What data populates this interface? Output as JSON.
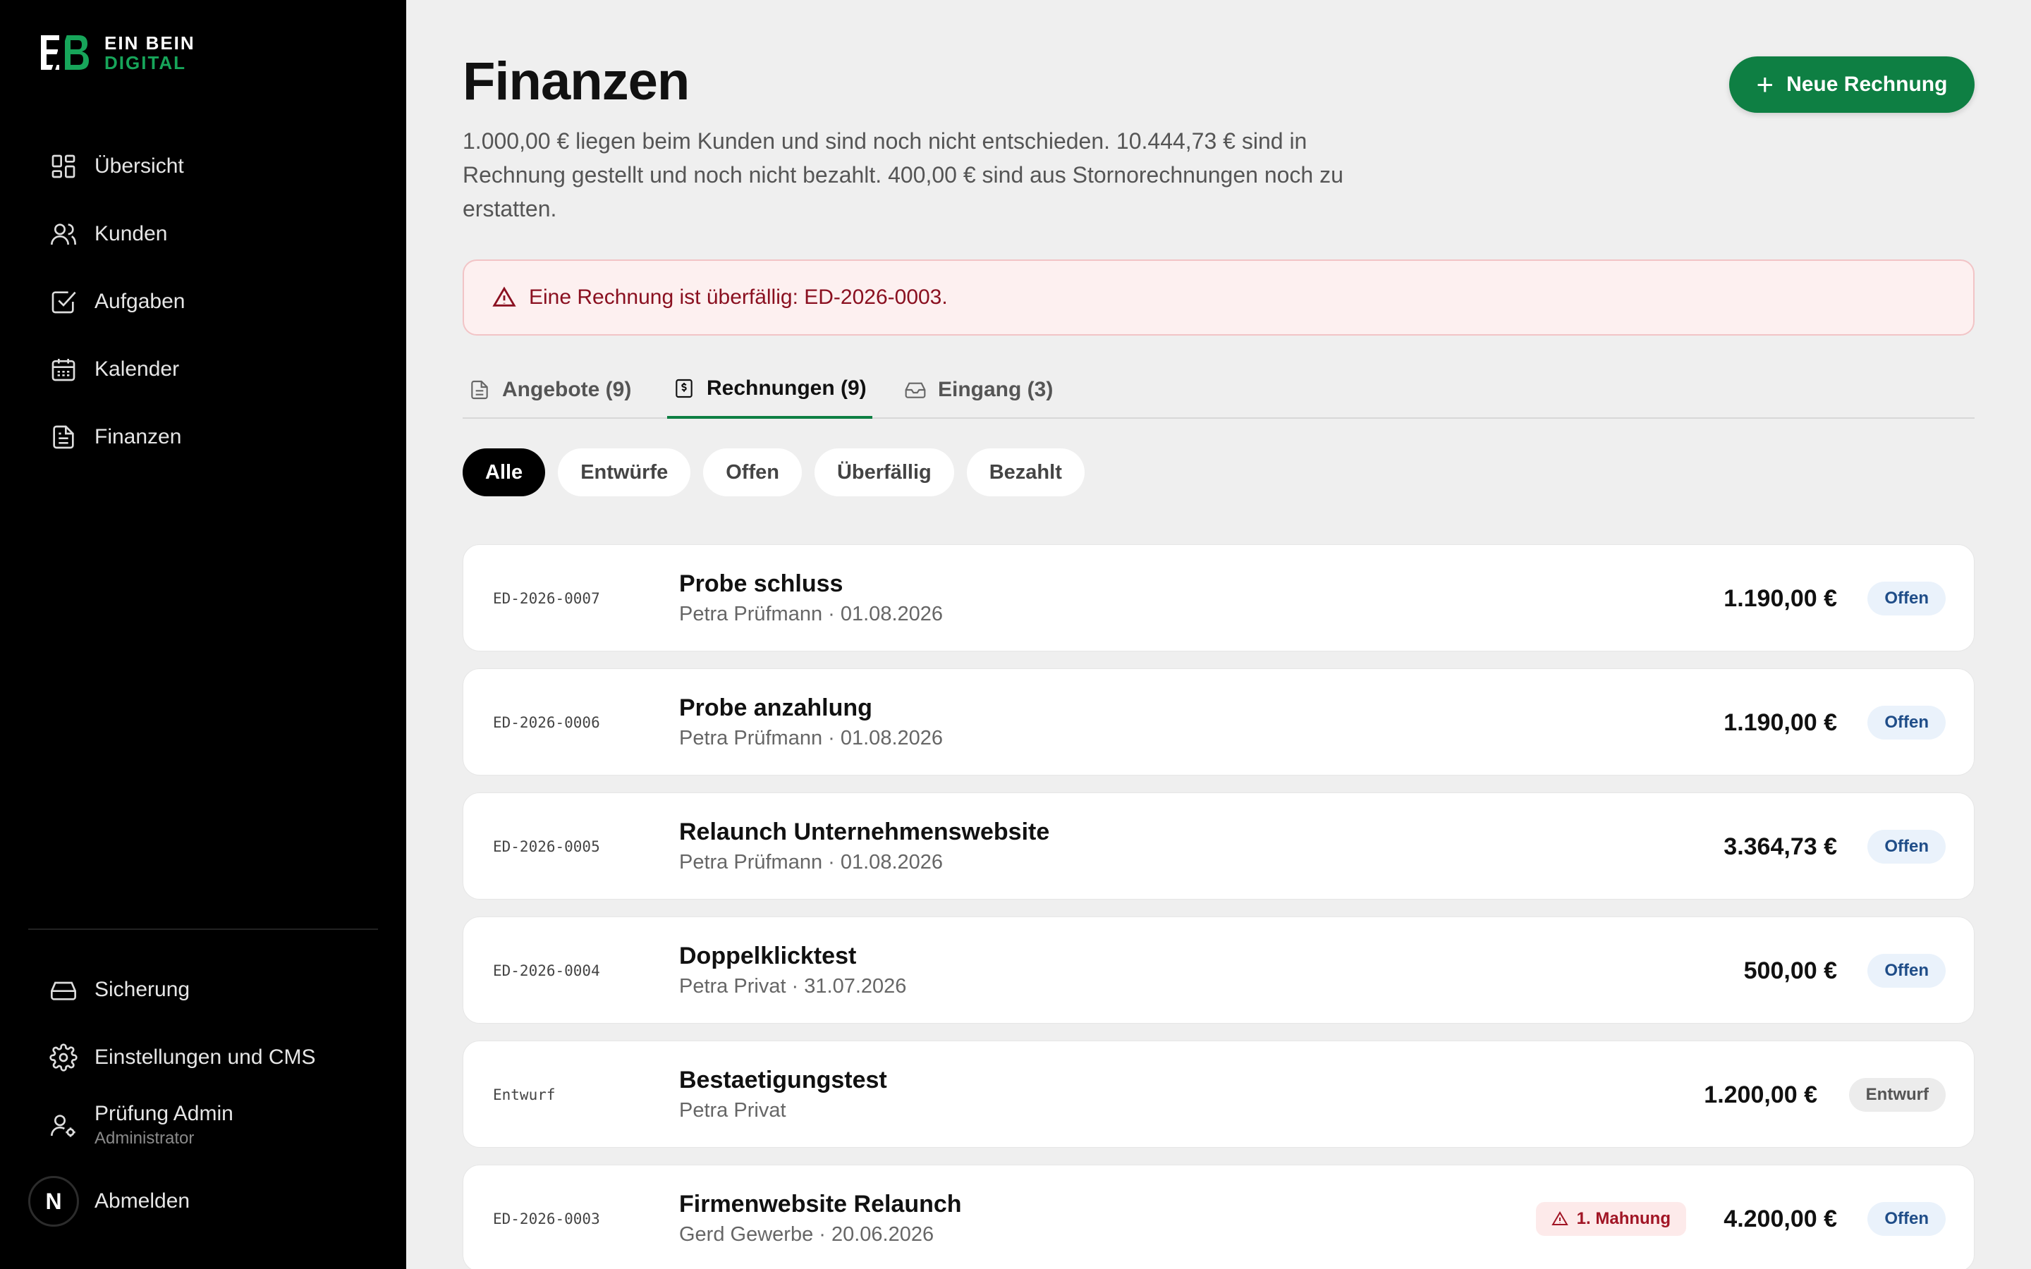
{
  "brand": {
    "line1": "EIN BEIN",
    "line2": "DIGITAL",
    "mark": "EB"
  },
  "sidebar": {
    "items": [
      {
        "label": "Übersicht",
        "icon": "dashboard-icon"
      },
      {
        "label": "Kunden",
        "icon": "users-icon"
      },
      {
        "label": "Aufgaben",
        "icon": "checkbox-icon"
      },
      {
        "label": "Kalender",
        "icon": "calendar-icon"
      },
      {
        "label": "Finanzen",
        "icon": "document-icon"
      }
    ],
    "bottom": [
      {
        "label": "Sicherung",
        "icon": "drive-icon"
      },
      {
        "label": "Einstellungen und CMS",
        "icon": "gear-icon"
      }
    ],
    "user": {
      "name": "Prüfung Admin",
      "role": "Administrator"
    },
    "logout": {
      "avatar": "N",
      "label": "Abmelden"
    }
  },
  "header": {
    "title": "Finanzen",
    "subtitle": "1.000,00 € liegen beim Kunden und sind noch nicht entschieden. 10.444,73 € sind in Rechnung gestellt und noch nicht bezahlt. 400,00 € sind aus Stornorechnungen noch zu erstatten.",
    "new_button": "Neue Rechnung"
  },
  "alert": {
    "text": "Eine Rechnung ist überfällig: ED-2026-0003."
  },
  "tabs": [
    {
      "label": "Angebote (9)"
    },
    {
      "label": "Rechnungen (9)"
    },
    {
      "label": "Eingang (3)"
    }
  ],
  "filters": [
    "Alle",
    "Entwürfe",
    "Offen",
    "Überfällig",
    "Bezahlt"
  ],
  "invoices": [
    {
      "number": "ED-2026-0007",
      "title": "Probe schluss",
      "meta": "Petra Prüfmann · 01.08.2026",
      "amount": "1.190,00 €",
      "status": "Offen"
    },
    {
      "number": "ED-2026-0006",
      "title": "Probe anzahlung",
      "meta": "Petra Prüfmann · 01.08.2026",
      "amount": "1.190,00 €",
      "status": "Offen"
    },
    {
      "number": "ED-2026-0005",
      "title": "Relaunch Unternehmenswebsite",
      "meta": "Petra Prüfmann · 01.08.2026",
      "amount": "3.364,73 €",
      "status": "Offen"
    },
    {
      "number": "ED-2026-0004",
      "title": "Doppelklicktest",
      "meta": "Petra Privat · 31.07.2026",
      "amount": "500,00 €",
      "status": "Offen"
    },
    {
      "number": "Entwurf",
      "title": "Bestaetigungstest",
      "meta": "Petra Privat",
      "amount": "1.200,00 €",
      "status": "Entwurf"
    },
    {
      "number": "ED-2026-0003",
      "title": "Firmenwebsite Relaunch",
      "meta": "Gerd Gewerbe · 20.06.2026",
      "amount": "4.200,00 €",
      "status": "Offen",
      "reminder": "1. Mahnung"
    }
  ],
  "colors": {
    "accent": "#0e7f43",
    "sidebar": "#000000",
    "alert_text": "#8a1020"
  }
}
